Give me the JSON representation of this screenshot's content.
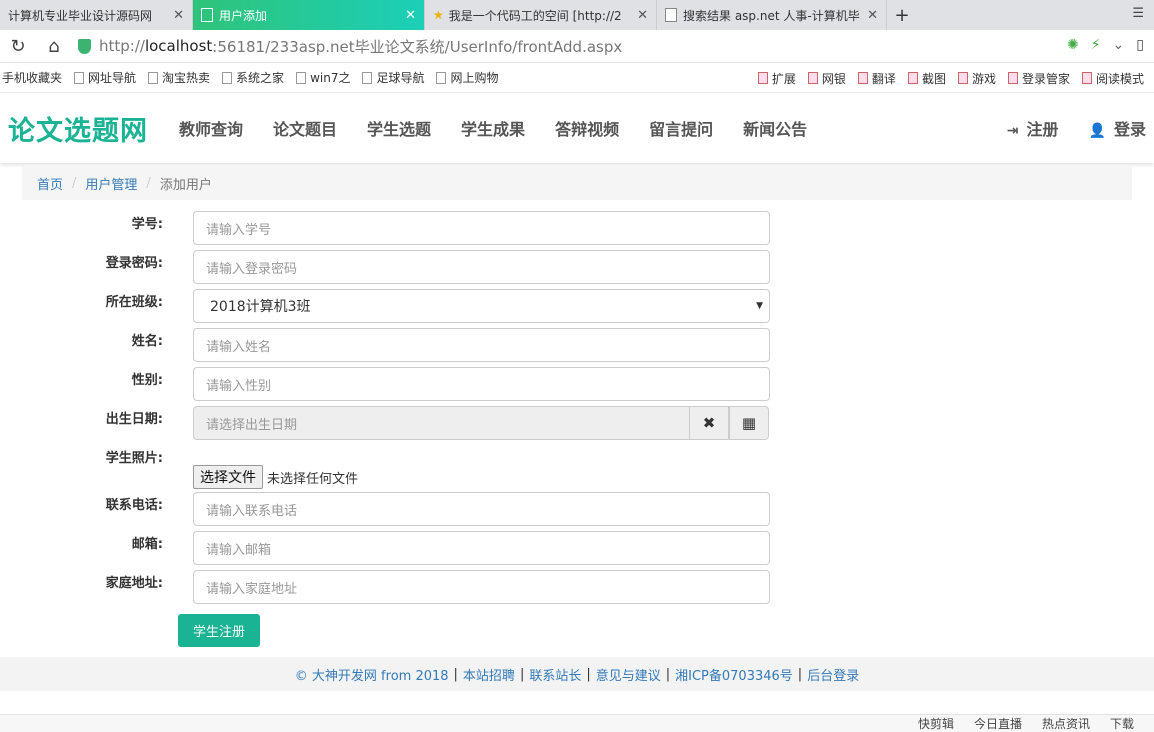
{
  "browser": {
    "tabs": [
      {
        "title": "计算机专业毕业设计源码网",
        "active": false
      },
      {
        "title": "用户添加",
        "active": true
      },
      {
        "title": "我是一个代码工的空间 [http://2",
        "active": false
      },
      {
        "title": "搜索结果 asp.net 人事-计算机毕",
        "active": false
      }
    ],
    "url_prefix": "http://",
    "url_host": "localhost",
    "url_rest": ":56181/233asp.net毕业论文系统/UserInfo/frontAdd.aspx",
    "bookmarks": [
      "手机收藏夹",
      "网址导航",
      "淘宝热卖",
      "系统之家",
      "win7之",
      "足球导航",
      "网上购物"
    ],
    "toolbar_right": [
      "扩展",
      "网银",
      "翻译",
      "截图",
      "游戏",
      "登录管家",
      "阅读模式"
    ]
  },
  "site": {
    "logo": "论文选题网",
    "menu": [
      "教师查询",
      "论文题目",
      "学生选题",
      "学生成果",
      "答辩视频",
      "留言提问",
      "新闻公告"
    ],
    "register": "注册",
    "login": "登录"
  },
  "breadcrumb": {
    "home": "首页",
    "section": "用户管理",
    "current": "添加用户"
  },
  "form": {
    "student_id": {
      "label": "学号:",
      "placeholder": "请输入学号"
    },
    "password": {
      "label": "登录密码:",
      "placeholder": "请输入登录密码"
    },
    "class": {
      "label": "所在班级:",
      "value": "2018计算机3班"
    },
    "name": {
      "label": "姓名:",
      "placeholder": "请输入姓名"
    },
    "gender": {
      "label": "性别:",
      "placeholder": "请输入性别"
    },
    "birthday": {
      "label": "出生日期:",
      "placeholder": "请选择出生日期"
    },
    "photo": {
      "label": "学生照片:",
      "button": "选择文件",
      "status": "未选择任何文件"
    },
    "phone": {
      "label": "联系电话:",
      "placeholder": "请输入联系电话"
    },
    "email": {
      "label": "邮箱:",
      "placeholder": "请输入邮箱"
    },
    "address": {
      "label": "家庭地址:",
      "placeholder": "请输入家庭地址"
    },
    "submit": "学生注册"
  },
  "footer": {
    "copyright": "© 大神开发网 from 2018",
    "links": [
      "本站招聘",
      "联系站长",
      "意见与建议",
      "湘ICP备0703346号",
      "后台登录"
    ]
  },
  "statusbar": [
    "快剪辑",
    "今日直播",
    "热点资讯",
    "下载"
  ]
}
